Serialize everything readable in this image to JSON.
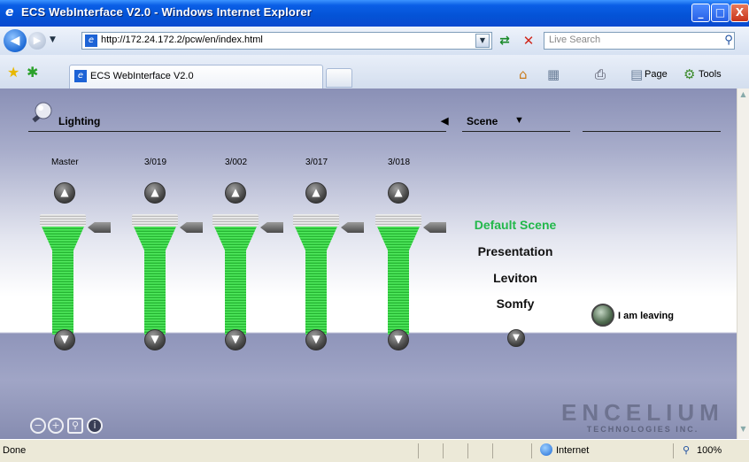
{
  "window": {
    "title": "ECS WebInterface V2.0 - Windows Internet Explorer",
    "min_label": "_",
    "max_label": "□",
    "close_label": "X"
  },
  "address": {
    "url": "http://172.24.172.2/pcw/en/index.html",
    "search_placeholder": "Live Search"
  },
  "tabs": [
    {
      "label": "ECS WebInterface V2.0",
      "active": true
    }
  ],
  "commands": {
    "page_label": "Page",
    "tools_label": "Tools"
  },
  "panel": {
    "section_label": "Lighting",
    "scene_label": "Scene",
    "channels": [
      {
        "label": "Master"
      },
      {
        "label": "3/019"
      },
      {
        "label": "3/002"
      },
      {
        "label": "3/017"
      },
      {
        "label": "3/018"
      }
    ],
    "scenes": [
      {
        "label": "Default Scene",
        "active": true,
        "color": "#22b84a"
      },
      {
        "label": "Presentation",
        "active": false,
        "color": "#111111"
      },
      {
        "label": "Leviton",
        "active": false,
        "color": "#111111"
      },
      {
        "label": "Somfy",
        "active": false,
        "color": "#111111"
      }
    ],
    "leaving_label": "I am leaving",
    "logo": {
      "main": "ENCELIUM",
      "sub": "TECHNOLOGIES INC."
    }
  },
  "status": {
    "text": "Done",
    "zone": "Internet",
    "zoom": "100%"
  },
  "colors": {
    "titlebar": "#0a5ee6",
    "fader_green": "#2fcc3c",
    "active_scene": "#22b84a"
  }
}
